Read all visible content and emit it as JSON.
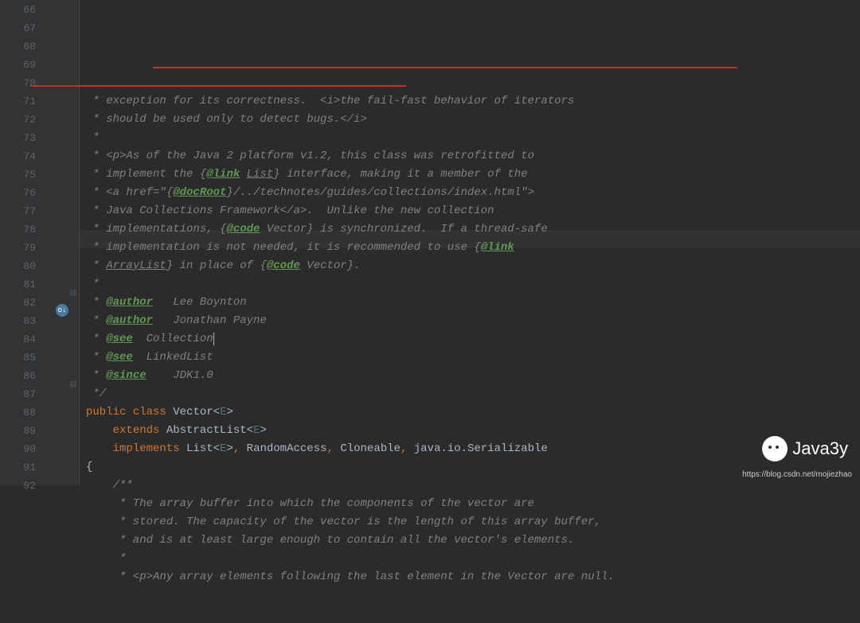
{
  "gutter": {
    "start": 66,
    "end": 92
  },
  "code": {
    "l66": " * exception for its correctness.  <i>the fail-fast behavior of iterators",
    "l67": " * should be used only to detect bugs.</i>",
    "l68": " *",
    "l69": {
      "pre": " * <p>",
      "text": "As of the Java 2 platform v1.2, this class was retrofitted to"
    },
    "l70": {
      "pre": " * ",
      "text1": "implement the {",
      "link": "@link",
      "space": " ",
      "list": "List",
      "text2": "} interface",
      "text3": ", making it a member of the"
    },
    "l71": {
      "pre": " * <a href=\"{",
      "docroot": "@docRoot",
      "post": "}/../technotes/guides/collections/index.html\">"
    },
    "l72": " * Java Collections Framework</a>.  Unlike the new collection",
    "l73": {
      "pre": " * implementations, {",
      "code": "@code",
      "post": " Vector} is synchronized.  If a thread-safe"
    },
    "l74": {
      "pre": " * implementation is not needed, it is recommended to use {",
      "link": "@link"
    },
    "l75": {
      "pre": " * ",
      "arr": "ArrayList",
      "mid": "} in place of {",
      "code": "@code",
      "post": " Vector}."
    },
    "l76": " *",
    "l77": {
      "pre": " * ",
      "tag": "@author",
      "val": "   Lee Boynton"
    },
    "l78": {
      "pre": " * ",
      "tag": "@author",
      "val": "   Jonathan Payne"
    },
    "l79": {
      "pre": " * ",
      "tag": "@see",
      "val": "  Collection"
    },
    "l80": {
      "pre": " * ",
      "tag": "@see",
      "val": "  LinkedList"
    },
    "l81": {
      "pre": " * ",
      "tag": "@since",
      "val": "    JDK1.0"
    },
    "l82": " */",
    "l83": {
      "pub": "public",
      "cls": "class",
      "name": "Vector",
      "gen": "E"
    },
    "l84": {
      "ext": "extends",
      "name": "AbstractList",
      "gen": "E"
    },
    "l85": {
      "impl": "implements",
      "list": "List",
      "gen": "E",
      "rest1": "RandomAccess",
      "rest2": "Cloneable",
      "rest3": "java.io.Serializable"
    },
    "l86": "{",
    "l87": "    /**",
    "l88": "     * The array buffer into which the components of the vector are",
    "l89": "     * stored. The capacity of the vector is the length of this array buffer,",
    "l90": "     * and is at least large enough to contain all the vector's elements.",
    "l91": "     *",
    "l92": "     * <p>Any array elements following the last element in the Vector are null."
  },
  "watermark": "https://blog.csdn.net/mojiezhao",
  "logo": "Java3y"
}
